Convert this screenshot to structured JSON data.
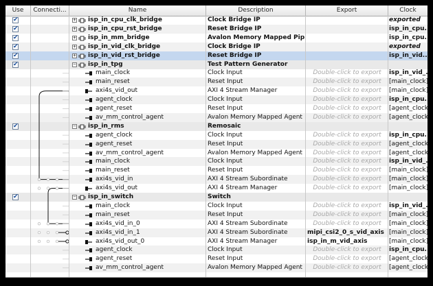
{
  "columns": {
    "use": "Use",
    "connections": "Connecti...",
    "name": "Name",
    "description": "Description",
    "export": "Export",
    "clock": "Clock"
  },
  "rows": [
    {
      "kind": "top",
      "use": true,
      "name": "isp_in_cpu_clk_bridge",
      "desc": "Clock Bridge IP",
      "export": "",
      "clock": "exported",
      "clockStyle": "ital",
      "alt": false
    },
    {
      "kind": "top",
      "use": true,
      "name": "isp_in_cpu_rst_bridge",
      "desc": "Reset Bridge IP",
      "export": "",
      "clock": "isp_in_cpu...",
      "clockStyle": "bold",
      "alt": true
    },
    {
      "kind": "top",
      "use": true,
      "name": "isp_in_mm_bridge",
      "desc": "Avalon Memory Mapped Pipeli...",
      "export": "",
      "clock": "isp_in_cpu...",
      "clockStyle": "bold",
      "alt": false
    },
    {
      "kind": "top",
      "use": true,
      "name": "isp_in_vid_clk_bridge",
      "desc": "Clock Bridge IP",
      "export": "",
      "clock": "exported",
      "clockStyle": "ital",
      "alt": true
    },
    {
      "kind": "top",
      "use": true,
      "name": "isp_in_vid_rst_bridge",
      "desc": "Reset Bridge IP",
      "export": "",
      "clock": "isp_in_vid...",
      "clockStyle": "bold",
      "selected": true
    },
    {
      "kind": "group",
      "use": true,
      "name": "isp_in_tpg",
      "desc": "Test Pattern Generator",
      "export": "",
      "clock": "",
      "clockStyle": ""
    },
    {
      "kind": "port",
      "name": "main_clock",
      "dir": "in",
      "desc": "Clock Input",
      "export": "Double-click to export",
      "clock": "isp_in_vid_...",
      "clockStyle": "bold",
      "alt": false
    },
    {
      "kind": "port",
      "name": "main_reset",
      "dir": "in",
      "desc": "Reset Input",
      "export": "Double-click to export",
      "clock": "[main_clock]",
      "clockStyle": "",
      "alt": true
    },
    {
      "kind": "port",
      "name": "axi4s_vid_out",
      "dir": "out",
      "desc": "AXI 4 Stream Manager",
      "export": "Double-click to export",
      "clock": "[main_clock]",
      "clockStyle": "",
      "alt": false
    },
    {
      "kind": "port",
      "name": "agent_clock",
      "dir": "in",
      "desc": "Clock Input",
      "export": "Double-click to export",
      "clock": "isp_in_cpu...",
      "clockStyle": "bold",
      "alt": true
    },
    {
      "kind": "port",
      "name": "agent_reset",
      "dir": "in",
      "desc": "Reset Input",
      "export": "Double-click to export",
      "clock": "[agent_clock]",
      "clockStyle": "",
      "alt": false
    },
    {
      "kind": "port",
      "name": "av_mm_control_agent",
      "dir": "in",
      "desc": "Avalon Memory Mapped Agent",
      "export": "Double-click to export",
      "clock": "[agent_clock]",
      "clockStyle": "",
      "alt": true
    },
    {
      "kind": "group",
      "use": true,
      "name": "isp_in_rms",
      "desc": "Remosaic",
      "export": "",
      "clock": "",
      "clockStyle": ""
    },
    {
      "kind": "port",
      "name": "agent_clock",
      "dir": "in",
      "desc": "Clock Input",
      "export": "Double-click to export",
      "clock": "isp_in_cpu...",
      "clockStyle": "bold",
      "alt": false
    },
    {
      "kind": "port",
      "name": "agent_reset",
      "dir": "in",
      "desc": "Reset Input",
      "export": "Double-click to export",
      "clock": "[agent_clock]",
      "clockStyle": "",
      "alt": true
    },
    {
      "kind": "port",
      "name": "av_mm_control_agent",
      "dir": "in",
      "desc": "Avalon Memory Mapped Agent",
      "export": "Double-click to export",
      "clock": "[agent_clock]",
      "clockStyle": "",
      "alt": false
    },
    {
      "kind": "port",
      "name": "main_clock",
      "dir": "in",
      "desc": "Clock Input",
      "export": "Double-click to export",
      "clock": "isp_in_vid_...",
      "clockStyle": "bold",
      "alt": true
    },
    {
      "kind": "port",
      "name": "main_reset",
      "dir": "in",
      "desc": "Reset Input",
      "export": "Double-click to export",
      "clock": "[main_clock]",
      "clockStyle": "",
      "alt": false
    },
    {
      "kind": "port",
      "name": "axi4s_vid_in",
      "dir": "in",
      "desc": "AXI 4 Stream Subordinate",
      "export": "Double-click to export",
      "clock": "[main_clock]",
      "clockStyle": "",
      "alt": true
    },
    {
      "kind": "port",
      "name": "axi4s_vid_out",
      "dir": "out",
      "desc": "AXI 4 Stream Manager",
      "export": "Double-click to export",
      "clock": "[main_clock]",
      "clockStyle": "",
      "alt": false
    },
    {
      "kind": "group",
      "use": true,
      "name": "isp_in_switch",
      "desc": "Switch",
      "export": "",
      "clock": "",
      "clockStyle": ""
    },
    {
      "kind": "port",
      "name": "main_clock",
      "dir": "in",
      "desc": "Clock Input",
      "export": "Double-click to export",
      "clock": "isp_in_vid_...",
      "clockStyle": "bold",
      "alt": false
    },
    {
      "kind": "port",
      "name": "main_reset",
      "dir": "in",
      "desc": "Reset Input",
      "export": "Double-click to export",
      "clock": "[main_clock]",
      "clockStyle": "",
      "alt": true
    },
    {
      "kind": "port",
      "name": "axi4s_vid_in_0",
      "dir": "in",
      "desc": "AXI 4 Stream Subordinate",
      "export": "Double-click to export",
      "clock": "[main_clock]",
      "clockStyle": "",
      "alt": false
    },
    {
      "kind": "port",
      "name": "axi4s_vid_in_1",
      "dir": "in",
      "desc": "AXI 4 Stream Subordinate",
      "export": "mipi_csi2_0_s_vid_axis",
      "exportStyle": "bold",
      "clock": "[main_clock]",
      "clockStyle": "",
      "alt": true
    },
    {
      "kind": "port",
      "name": "axi4s_vid_out_0",
      "dir": "out",
      "desc": "AXI 4 Stream Manager",
      "export": "isp_in_m_vid_axis",
      "exportStyle": "bold",
      "clock": "[main_clock]",
      "clockStyle": "",
      "alt": false
    },
    {
      "kind": "port",
      "name": "agent_clock",
      "dir": "in",
      "desc": "Clock Input",
      "export": "Double-click to export",
      "clock": "isp_in_cpu...",
      "clockStyle": "bold",
      "alt": true
    },
    {
      "kind": "port",
      "name": "agent_reset",
      "dir": "in",
      "desc": "Reset Input",
      "export": "Double-click to export",
      "clock": "[agent_clock]",
      "clockStyle": "",
      "alt": false
    },
    {
      "kind": "port",
      "name": "av_mm_control_agent",
      "dir": "in",
      "desc": "Avalon Memory Mapped Agent",
      "export": "Double-click to export",
      "clock": "[agent_clock]",
      "clockStyle": "",
      "alt": true
    }
  ]
}
